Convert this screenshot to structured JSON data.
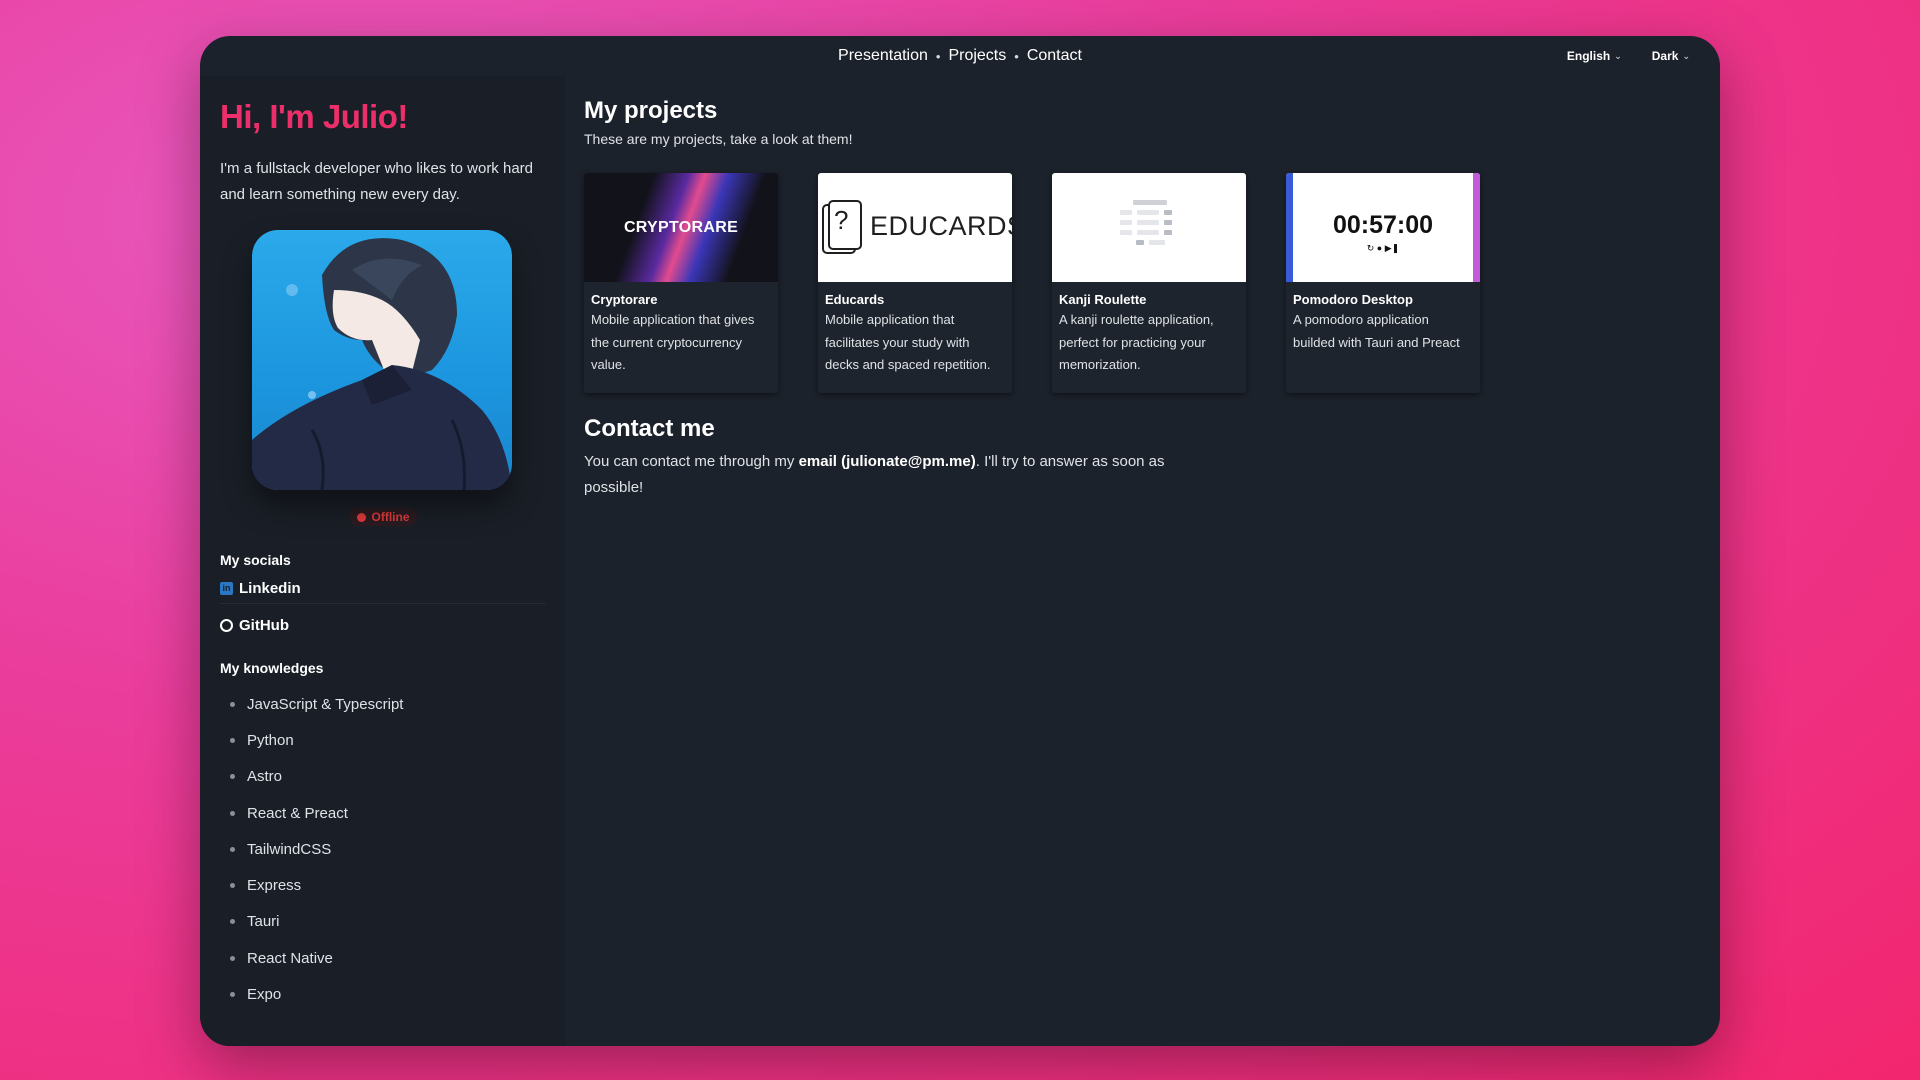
{
  "topbar": {
    "nav": [
      {
        "label": "Presentation"
      },
      {
        "label": "Projects"
      },
      {
        "label": "Contact"
      }
    ],
    "separator": "•",
    "language": "English",
    "theme": "Dark"
  },
  "sidebar": {
    "greeting": "Hi, I'm Julio!",
    "intro": "I'm a fullstack developer who likes to work hard and learn something new every day.",
    "status": "Offline",
    "socials_heading": "My socials",
    "socials": [
      {
        "label": "Linkedin",
        "icon": "linkedin-icon"
      },
      {
        "label": "GitHub",
        "icon": "github-icon"
      }
    ],
    "knowledges_heading": "My knowledges",
    "knowledges": [
      "JavaScript & Typescript",
      "Python",
      "Astro",
      "React & Preact",
      "TailwindCSS",
      "Express",
      "Tauri",
      "React Native",
      "Expo"
    ]
  },
  "projects": {
    "title": "My projects",
    "subtitle": "These are my projects, take a look at them!",
    "items": [
      {
        "name": "Cryptorare",
        "description": "Mobile application that gives the current cryptocurrency value.",
        "thumb_text": "CRYPTORARE"
      },
      {
        "name": "Educards",
        "description": "Mobile application that facilitates your study with decks and spaced repetition.",
        "thumb_text": "EDUCARDS"
      },
      {
        "name": "Kanji Roulette",
        "description": "A kanji roulette application, perfect for practicing your memorization.",
        "thumb_text": ""
      },
      {
        "name": "Pomodoro Desktop",
        "description": "A pomodoro application builded with Tauri and Preact",
        "thumb_text": "00:57:00"
      }
    ]
  },
  "contact": {
    "title": "Contact me",
    "text_before": "You can contact me through my ",
    "email_link": "email (julionate@pm.me)",
    "text_after": ". I'll try to answer as soon as possible!"
  },
  "colors": {
    "accent": "#ec2f6b",
    "window_bg": "#1c222b",
    "sidebar_bg": "#1a1f27",
    "status_offline": "#e03b3b"
  }
}
